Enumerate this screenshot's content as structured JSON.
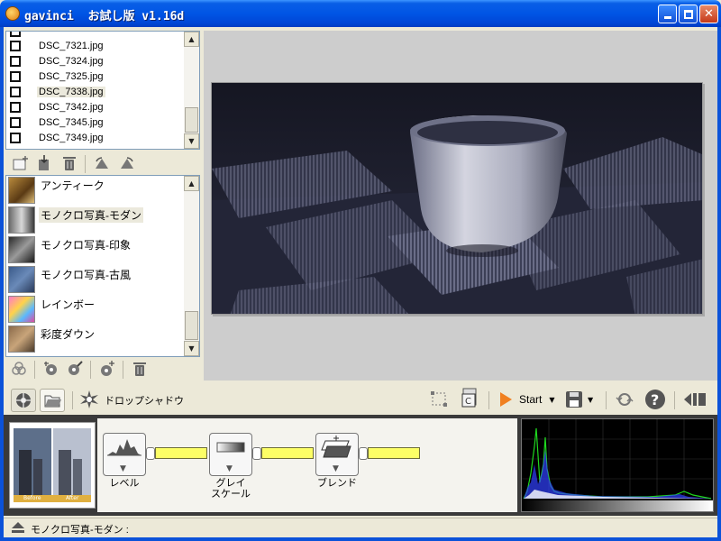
{
  "window": {
    "title": "gavinci  お試し版 v1.16d",
    "minimize_icon": "minimize-icon",
    "maximize_icon": "maximize-icon",
    "close_icon": "close-icon"
  },
  "file_list": {
    "items": [
      {
        "name": "DSC_7321.jpg",
        "checked": false,
        "selected": false
      },
      {
        "name": "DSC_7324.jpg",
        "checked": false,
        "selected": false
      },
      {
        "name": "DSC_7325.jpg",
        "checked": false,
        "selected": false
      },
      {
        "name": "DSC_7338.jpg",
        "checked": false,
        "selected": true
      },
      {
        "name": "DSC_7342.jpg",
        "checked": false,
        "selected": false
      },
      {
        "name": "DSC_7345.jpg",
        "checked": false,
        "selected": false
      },
      {
        "name": "DSC_7349.jpg",
        "checked": false,
        "selected": false
      }
    ]
  },
  "file_toolbar": [
    "add-folder-icon",
    "import-file-icon",
    "delete-icon",
    "rotate-left-icon",
    "rotate-right-icon"
  ],
  "filter_list": {
    "items": [
      {
        "name": "アンティーク",
        "selected": false
      },
      {
        "name": "モノクロ写真-モダン",
        "selected": true
      },
      {
        "name": "モノクロ写真-印象",
        "selected": false
      },
      {
        "name": "モノクロ写真-古風",
        "selected": false
      },
      {
        "name": "レインボー",
        "selected": false
      },
      {
        "name": "彩度ダウン",
        "selected": false
      }
    ]
  },
  "filter_toolbar": [
    "filter-group-icon",
    "new-filter-icon",
    "edit-filter-icon",
    "add-filter-icon",
    "delete-filter-icon"
  ],
  "bottom_toolbar": {
    "mode_icons": [
      "aperture-mode-icon",
      "folder-mode-icon"
    ],
    "effect_label": "ドロップシャドウ",
    "start_label": "Start"
  },
  "chain": {
    "nodes": [
      {
        "label": "レベル",
        "icon": "levels-icon"
      },
      {
        "label": "グレイ\nスケール",
        "icon": "grayscale-icon"
      },
      {
        "label": "ブレンド",
        "icon": "blend-icon"
      }
    ],
    "thumbnail_labels": [
      "Before",
      "After"
    ]
  },
  "status": {
    "text": "モノクロ写真-モダン :"
  },
  "colors": {
    "titlebar": "#0055e5",
    "node_bar": "#fdff66",
    "histogram_green": "#1fd81f",
    "histogram_blue": "#3040ff"
  }
}
